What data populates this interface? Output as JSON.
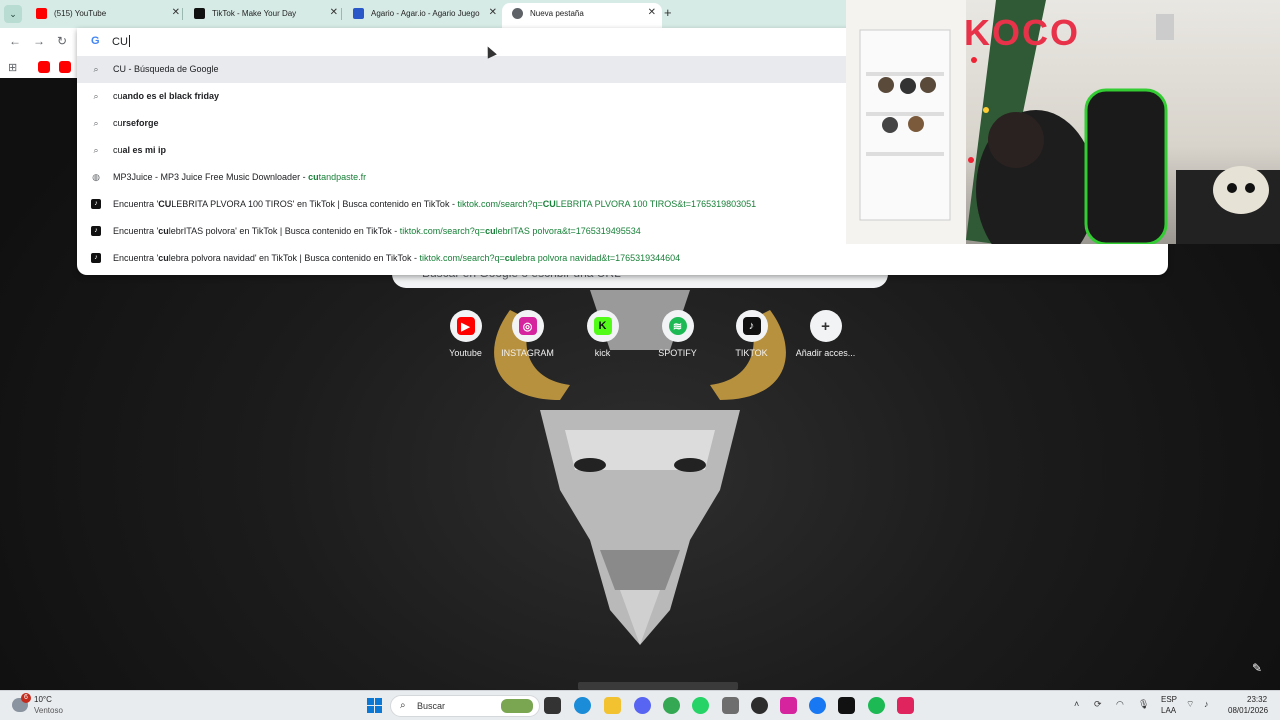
{
  "tabs": [
    {
      "title": "(515) YouTube",
      "color": "#ff0000",
      "active": false
    },
    {
      "title": "TikTok - Make Your Day",
      "color": "#111111",
      "active": false
    },
    {
      "title": "Agario - Agar.io - Agario Juego",
      "color": "#2b58c8",
      "active": false
    },
    {
      "title": "Nueva pestaña",
      "color": "#5f6368",
      "active": true
    }
  ],
  "tab_close": "✕",
  "new_tab_label": "+",
  "omnibox": {
    "typed": "CU",
    "suggestions": [
      {
        "icon": "search-icon",
        "bold": "",
        "plain": "CU - Búsqueda de Google",
        "url": ""
      },
      {
        "icon": "search-icon",
        "pre": "cu",
        "bold": "ando es el black friday",
        "url": ""
      },
      {
        "icon": "search-icon",
        "pre": "cu",
        "bold": "rseforge",
        "url": ""
      },
      {
        "icon": "search-icon",
        "pre": "cu",
        "bold": "al es mi ip",
        "url": ""
      },
      {
        "icon": "globe-icon",
        "plain": "MP3Juice - MP3 Juice Free Music Downloader - ",
        "url_b": "cu",
        "url": "tandpaste.fr"
      },
      {
        "icon": "tiktok-icon",
        "t1": "Encuentra '",
        "tb": "CU",
        "t2": "LEBRITA PLVORA 100 TIROS' en TikTok | Busca contenido en TikTok - ",
        "u1": "tiktok.com/search?q=",
        "ub": "CU",
        "u2": "LEBRITA PLVORA 100 TIROS&t=1765319803051"
      },
      {
        "icon": "tiktok-icon",
        "t1": "Encuentra '",
        "tb": "cu",
        "t2": "lebrITAS polvora' en TikTok | Busca contenido en TikTok - ",
        "u1": "tiktok.com/search?q=",
        "ub": "cu",
        "u2": "lebrITAS polvora&t=1765319495534"
      },
      {
        "icon": "tiktok-icon",
        "t1": "Encuentra '",
        "tb": "cu",
        "t2": "lebra polvora navidad' en TikTok | Busca contenido en TikTok - ",
        "u1": "tiktok.com/search?q=",
        "ub": "cu",
        "u2": "lebra polvora navidad&t=1765319344604"
      }
    ]
  },
  "ntp": {
    "search_placeholder": "Buscar en Google o escribir una URL",
    "shortcuts": [
      {
        "label": "Youtube",
        "glyph": "▶",
        "color": "#ff0000"
      },
      {
        "label": "INSTAGRAM",
        "glyph": "◎",
        "color": "#d6249f"
      },
      {
        "label": "kick",
        "glyph": "K",
        "color": "#53fc18"
      },
      {
        "label": "SPOTIFY",
        "glyph": "≋",
        "color": "#1db954"
      },
      {
        "label": "TIKTOK",
        "glyph": "♪",
        "color": "#111111"
      },
      {
        "label": "Añadir acces...",
        "glyph": "+",
        "color": "#f1f3f4"
      }
    ]
  },
  "webcam": {
    "wall_text": "KOCO"
  },
  "taskbar": {
    "weather_temp": "10°C",
    "weather_desc": "Ventoso",
    "weather_badge": "6",
    "search_placeholder": "Buscar",
    "lang_1": "ESP",
    "lang_2": "LAA",
    "time": "23:32",
    "date": "08/01/2026"
  }
}
